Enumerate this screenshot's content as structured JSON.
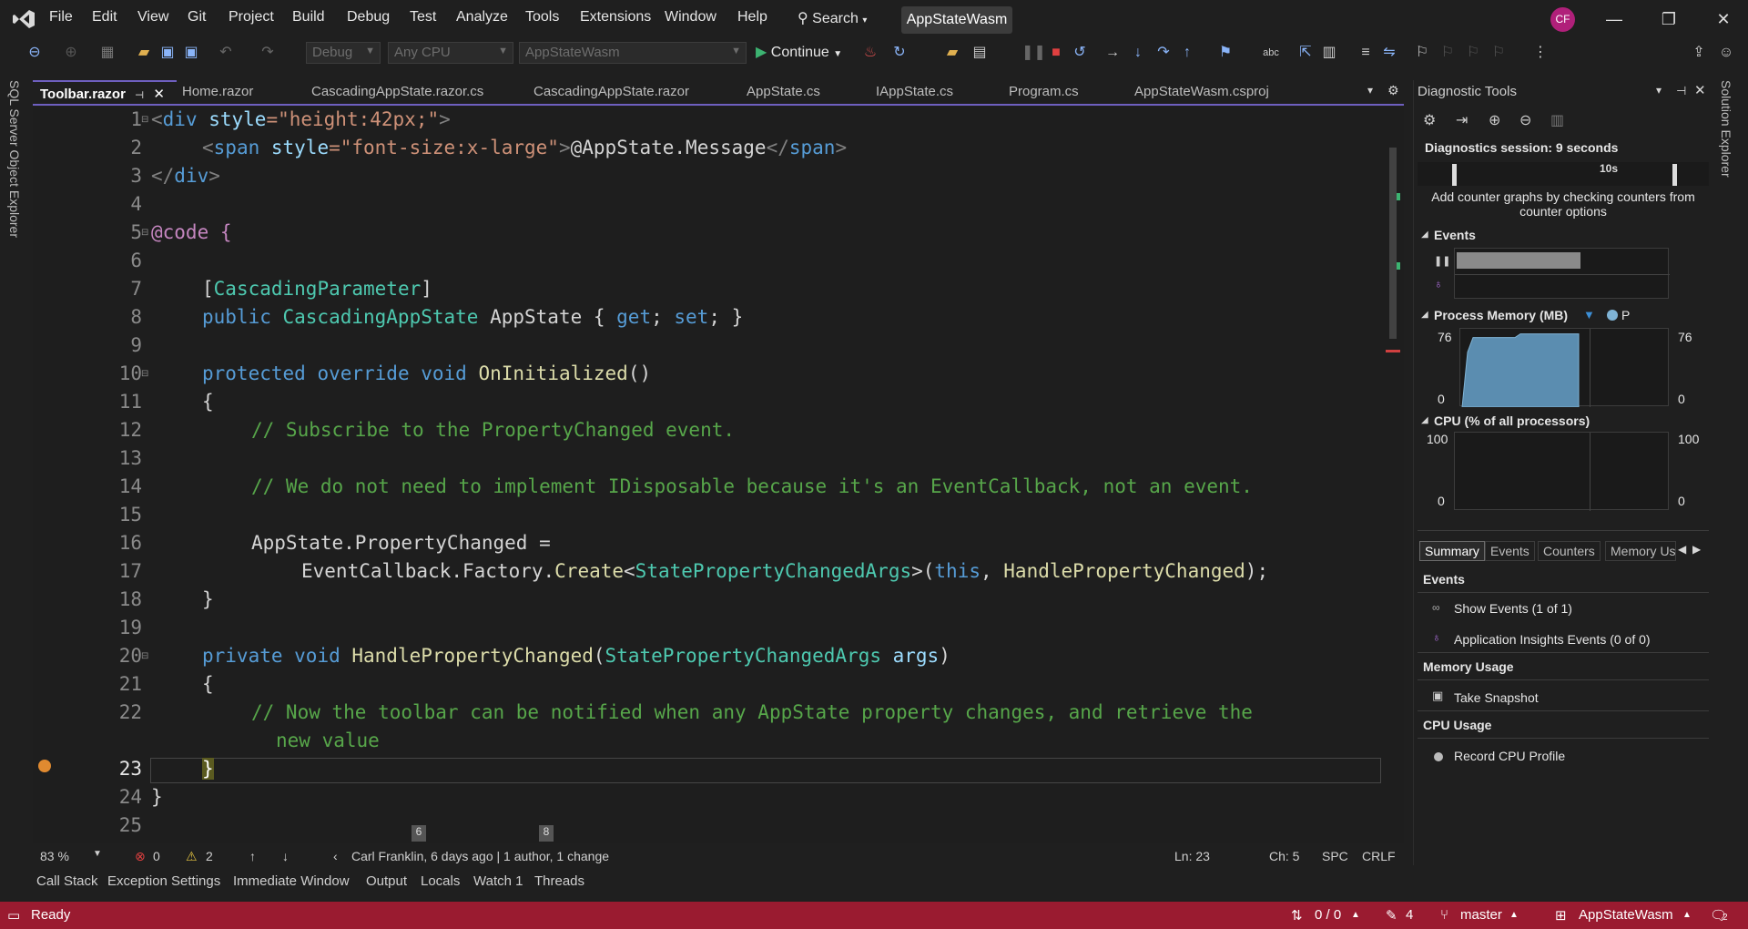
{
  "menu": [
    "File",
    "Edit",
    "View",
    "Git",
    "Project",
    "Build",
    "Debug",
    "Test",
    "Analyze",
    "Tools",
    "Extensions",
    "Window",
    "Help"
  ],
  "search_label": "Search",
  "solution_name": "AppStateWasm",
  "user_initials": "CF",
  "toolbar": {
    "config": "Debug",
    "platform": "Any CPU",
    "startup": "AppStateWasm",
    "continue_label": "Continue"
  },
  "side_tabs": {
    "left": "SQL Server Object Explorer",
    "right": "Solution Explorer"
  },
  "doc_tabs": [
    "Toolbar.razor",
    "Home.razor",
    "CascadingAppState.razor.cs",
    "CascadingAppState.razor",
    "AppState.cs",
    "IAppState.cs",
    "Program.cs",
    "AppStateWasm.csproj"
  ],
  "editor": {
    "line_numbers": [
      "1",
      "2",
      "3",
      "4",
      "5",
      "6",
      "7",
      "8",
      "9",
      "10",
      "11",
      "12",
      "13",
      "14",
      "15",
      "16",
      "17",
      "18",
      "19",
      "20",
      "21",
      "22",
      "23",
      "24",
      "25"
    ],
    "lines": {
      "l1a": "<",
      "l1b": "div",
      "l1c": " style",
      "l1d": "=\"height:42px;\"",
      "l1e": ">",
      "l2a": "<",
      "l2b": "span",
      "l2c": " style",
      "l2d": "=\"font-size:x-large\"",
      "l2e": ">",
      "l2f": "@AppState.Message",
      "l2g": "</",
      "l2h": "span",
      "l2i": ">",
      "l3a": "</",
      "l3b": "div",
      "l3c": ">",
      "l5a": "@code",
      "l5b": " {",
      "l7a": "[",
      "l7b": "CascadingParameter",
      "l7c": "]",
      "l8a": "public",
      "l8b": " CascadingAppState",
      "l8c": " AppState { ",
      "l8d": "get",
      "l8e": "; ",
      "l8f": "set",
      "l8g": "; }",
      "l10a": "protected",
      "l10b": " override",
      "l10c": " void",
      "l10d": " OnInitialized",
      "l10e": "()",
      "l11": "{",
      "l12": "// Subscribe to the PropertyChanged event.",
      "l14": "// We do not need to implement IDisposable because it's an EventCallback, not an event.",
      "l16": "AppState.PropertyChanged =",
      "l17a": "EventCallback.Factory.",
      "l17b": "Create",
      "l17c": "<",
      "l17d": "StatePropertyChangedArgs",
      "l17e": ">(",
      "l17f": "this",
      "l17g": ", ",
      "l17h": "HandlePropertyChanged",
      "l17i": ");",
      "l18": "}",
      "l20a": "private",
      "l20b": " void",
      "l20c": " HandlePropertyChanged",
      "l20d": "(",
      "l20e": "StatePropertyChangedArgs",
      "l20f": " args",
      "l20g": ")",
      "l21": "{",
      "l22a": "// Now the toolbar can be notified when any AppState property changes, and retrieve the",
      "l22b": "new value",
      "l23": "}",
      "l24": "}"
    }
  },
  "codelens": {
    "author": "Carl Franklin, 6 days ago | 1 author, 1 change",
    "marker_a": "6",
    "marker_b": "8"
  },
  "editor_status": {
    "zoom": "83 %",
    "errors": "0",
    "warnings": "2",
    "ln": "Ln: 23",
    "ch": "Ch: 5",
    "spc": "SPC",
    "crlf": "CRLF"
  },
  "bottom_tabs": [
    "Call Stack",
    "Exception Settings",
    "Immediate Window",
    "Output",
    "Locals",
    "Watch 1",
    "Threads"
  ],
  "statusbar": {
    "ready": "Ready",
    "sync": "0 / 0",
    "pending": "4",
    "branch": "master",
    "repo": "AppStateWasm",
    "notifications": "2"
  },
  "diagnostics": {
    "title": "Diagnostic Tools",
    "session": "Diagnostics session: 9 seconds",
    "timeline_label": "10s",
    "counter_hint": "Add counter graphs by checking counters from counter options",
    "events_section": "Events",
    "memory_section": "Process Memory (MB)",
    "memory_legend": "P",
    "memory_max": "76",
    "memory_min": "0",
    "cpu_section": "CPU (% of all processors)",
    "cpu_max": "100",
    "cpu_min": "0",
    "memory_fill_fraction": 0.98,
    "tabs": [
      "Summary",
      "Events",
      "Counters",
      "Memory Us"
    ],
    "events_heading": "Events",
    "show_events": "Show Events (1 of 1)",
    "insights_events": "Application Insights Events (0 of 0)",
    "memory_heading": "Memory Usage",
    "take_snapshot": "Take Snapshot",
    "cpu_heading": "CPU Usage",
    "record_cpu": "Record CPU Profile"
  },
  "colors": {
    "accent": "#6e5fbf",
    "statusbar": "#9a1b30",
    "comment": "#57a64a",
    "keyword": "#569cd6",
    "type": "#4ec9b0"
  }
}
